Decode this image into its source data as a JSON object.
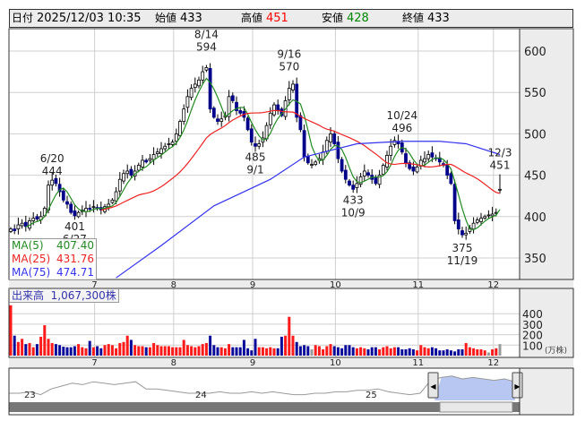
{
  "header": {
    "date_label": "日付",
    "datetime": "2025/12/03 10:35",
    "open_label": "始値",
    "open": "433",
    "high_label": "高値",
    "high": "451",
    "low_label": "安値",
    "low": "428",
    "close_label": "終値",
    "close": "433"
  },
  "legend": {
    "ma5_label": "MA(5)",
    "ma5_value": "407.40",
    "ma25_label": "MA(25)",
    "ma25_value": "431.76",
    "ma75_label": "MA(75)",
    "ma75_value": "474.71"
  },
  "volume_label": "出来高",
  "volume_value": "1,067,300株",
  "volume_unit": "(万株)",
  "colors": {
    "up_fill": "#ffffff",
    "down_fill": "#00008b",
    "vol_up": "#ff1a1a",
    "vol_down": "#0a0a9a",
    "ma5": "#228b22",
    "ma25": "#ee2222",
    "ma75": "#3333ee"
  },
  "chart_data": {
    "type": "candlestick",
    "price_ticks": [
      350,
      400,
      450,
      500,
      550,
      600
    ],
    "ylim": [
      325,
      625
    ],
    "volume_ticks": [
      100,
      200,
      300,
      400
    ],
    "month_labels": [
      {
        "label": "7",
        "index": 23
      },
      {
        "label": "8",
        "index": 44
      },
      {
        "label": "9",
        "index": 65
      },
      {
        "label": "10",
        "index": 87
      },
      {
        "label": "11",
        "index": 109
      },
      {
        "label": "12",
        "index": 129
      }
    ],
    "closes": [
      385,
      383,
      390,
      392,
      388,
      395,
      398,
      397,
      400,
      410,
      438,
      444,
      440,
      430,
      420,
      415,
      405,
      401,
      405,
      408,
      410,
      409,
      412,
      410,
      408,
      412,
      415,
      420,
      430,
      445,
      452,
      455,
      450,
      455,
      462,
      468,
      466,
      470,
      475,
      478,
      482,
      485,
      488,
      490,
      500,
      515,
      530,
      545,
      555,
      560,
      565,
      575,
      580,
      530,
      520,
      515,
      518,
      522,
      545,
      540,
      528,
      525,
      520,
      505,
      490,
      485,
      488,
      495,
      510,
      525,
      535,
      528,
      522,
      540,
      555,
      560,
      520,
      505,
      472,
      465,
      463,
      466,
      470,
      478,
      492,
      500,
      488,
      470,
      455,
      445,
      438,
      433,
      440,
      448,
      455,
      450,
      445,
      440,
      450,
      462,
      474,
      485,
      492,
      488,
      478,
      465,
      458,
      455,
      460,
      468,
      470,
      475,
      472,
      470,
      466,
      462,
      450,
      440,
      395,
      385,
      378,
      380,
      386,
      392,
      396,
      398,
      400,
      402,
      403,
      405,
      433
    ],
    "last_bar": {
      "open": 433,
      "high": 451,
      "low": 428,
      "close": 433
    },
    "volumes": [
      480,
      190,
      130,
      160,
      110,
      120,
      80,
      110,
      180,
      290,
      160,
      120,
      110,
      100,
      85,
      80,
      80,
      90,
      110,
      80,
      70,
      140,
      80,
      90,
      70,
      100,
      110,
      100,
      70,
      120,
      130,
      190,
      150,
      100,
      90,
      90,
      80,
      80,
      120,
      100,
      90,
      90,
      90,
      80,
      80,
      80,
      150,
      100,
      90,
      80,
      90,
      110,
      120,
      190,
      100,
      80,
      80,
      70,
      110,
      80,
      80,
      80,
      150,
      70,
      50,
      160,
      80,
      80,
      70,
      80,
      70,
      70,
      180,
      190,
      370,
      190,
      130,
      90,
      100,
      90,
      60,
      100,
      90,
      60,
      90,
      110,
      90,
      80,
      70,
      100,
      100,
      80,
      70,
      80,
      70,
      60,
      80,
      80,
      60,
      80,
      90,
      70,
      80,
      80,
      60,
      60,
      70,
      60,
      50,
      100,
      80,
      70,
      80,
      70,
      50,
      50,
      60,
      50,
      40,
      60,
      60,
      120,
      80,
      70,
      60,
      60,
      50,
      30,
      60,
      70,
      110
    ],
    "ma75_points": [
      [
        28,
        326
      ],
      [
        40,
        365
      ],
      [
        54,
        413
      ],
      [
        69,
        445
      ],
      [
        78,
        472
      ],
      [
        92,
        488
      ],
      [
        104,
        491
      ],
      [
        114,
        491
      ],
      [
        121,
        488
      ],
      [
        130,
        475
      ]
    ],
    "annotations": [
      {
        "date": "6/20",
        "value": "444",
        "index": 11,
        "price": 444,
        "pos": "above"
      },
      {
        "date": "6/27",
        "value": "401",
        "index": 17,
        "price": 401,
        "pos": "below"
      },
      {
        "date": "8/14",
        "value": "594",
        "index": 52,
        "price": 594,
        "pos": "above"
      },
      {
        "date": "9/1",
        "value": "485",
        "index": 65,
        "price": 485,
        "pos": "below"
      },
      {
        "date": "9/16",
        "value": "570",
        "index": 74,
        "price": 570,
        "pos": "above"
      },
      {
        "date": "10/9",
        "value": "433",
        "index": 91,
        "price": 433,
        "pos": "below"
      },
      {
        "date": "10/24",
        "value": "496",
        "index": 104,
        "price": 496,
        "pos": "above"
      },
      {
        "date": "11/19",
        "value": "375",
        "index": 120,
        "price": 375,
        "pos": "below"
      },
      {
        "date": "12/3",
        "value": "451",
        "index": 130,
        "price": 451,
        "pos": "above"
      }
    ]
  },
  "navigator": {
    "year_labels": [
      "23",
      "24",
      "25"
    ],
    "series": [
      5,
      5,
      6,
      4,
      8,
      10,
      12,
      11,
      13,
      12,
      11,
      12,
      13,
      8,
      8,
      7,
      6,
      5,
      5,
      5,
      6,
      5,
      5,
      6,
      5,
      6,
      5,
      4,
      4,
      5,
      5,
      6,
      6,
      7,
      7,
      8,
      6,
      5,
      4,
      5,
      14,
      16,
      17,
      15,
      16,
      15,
      14,
      15,
      13
    ]
  }
}
